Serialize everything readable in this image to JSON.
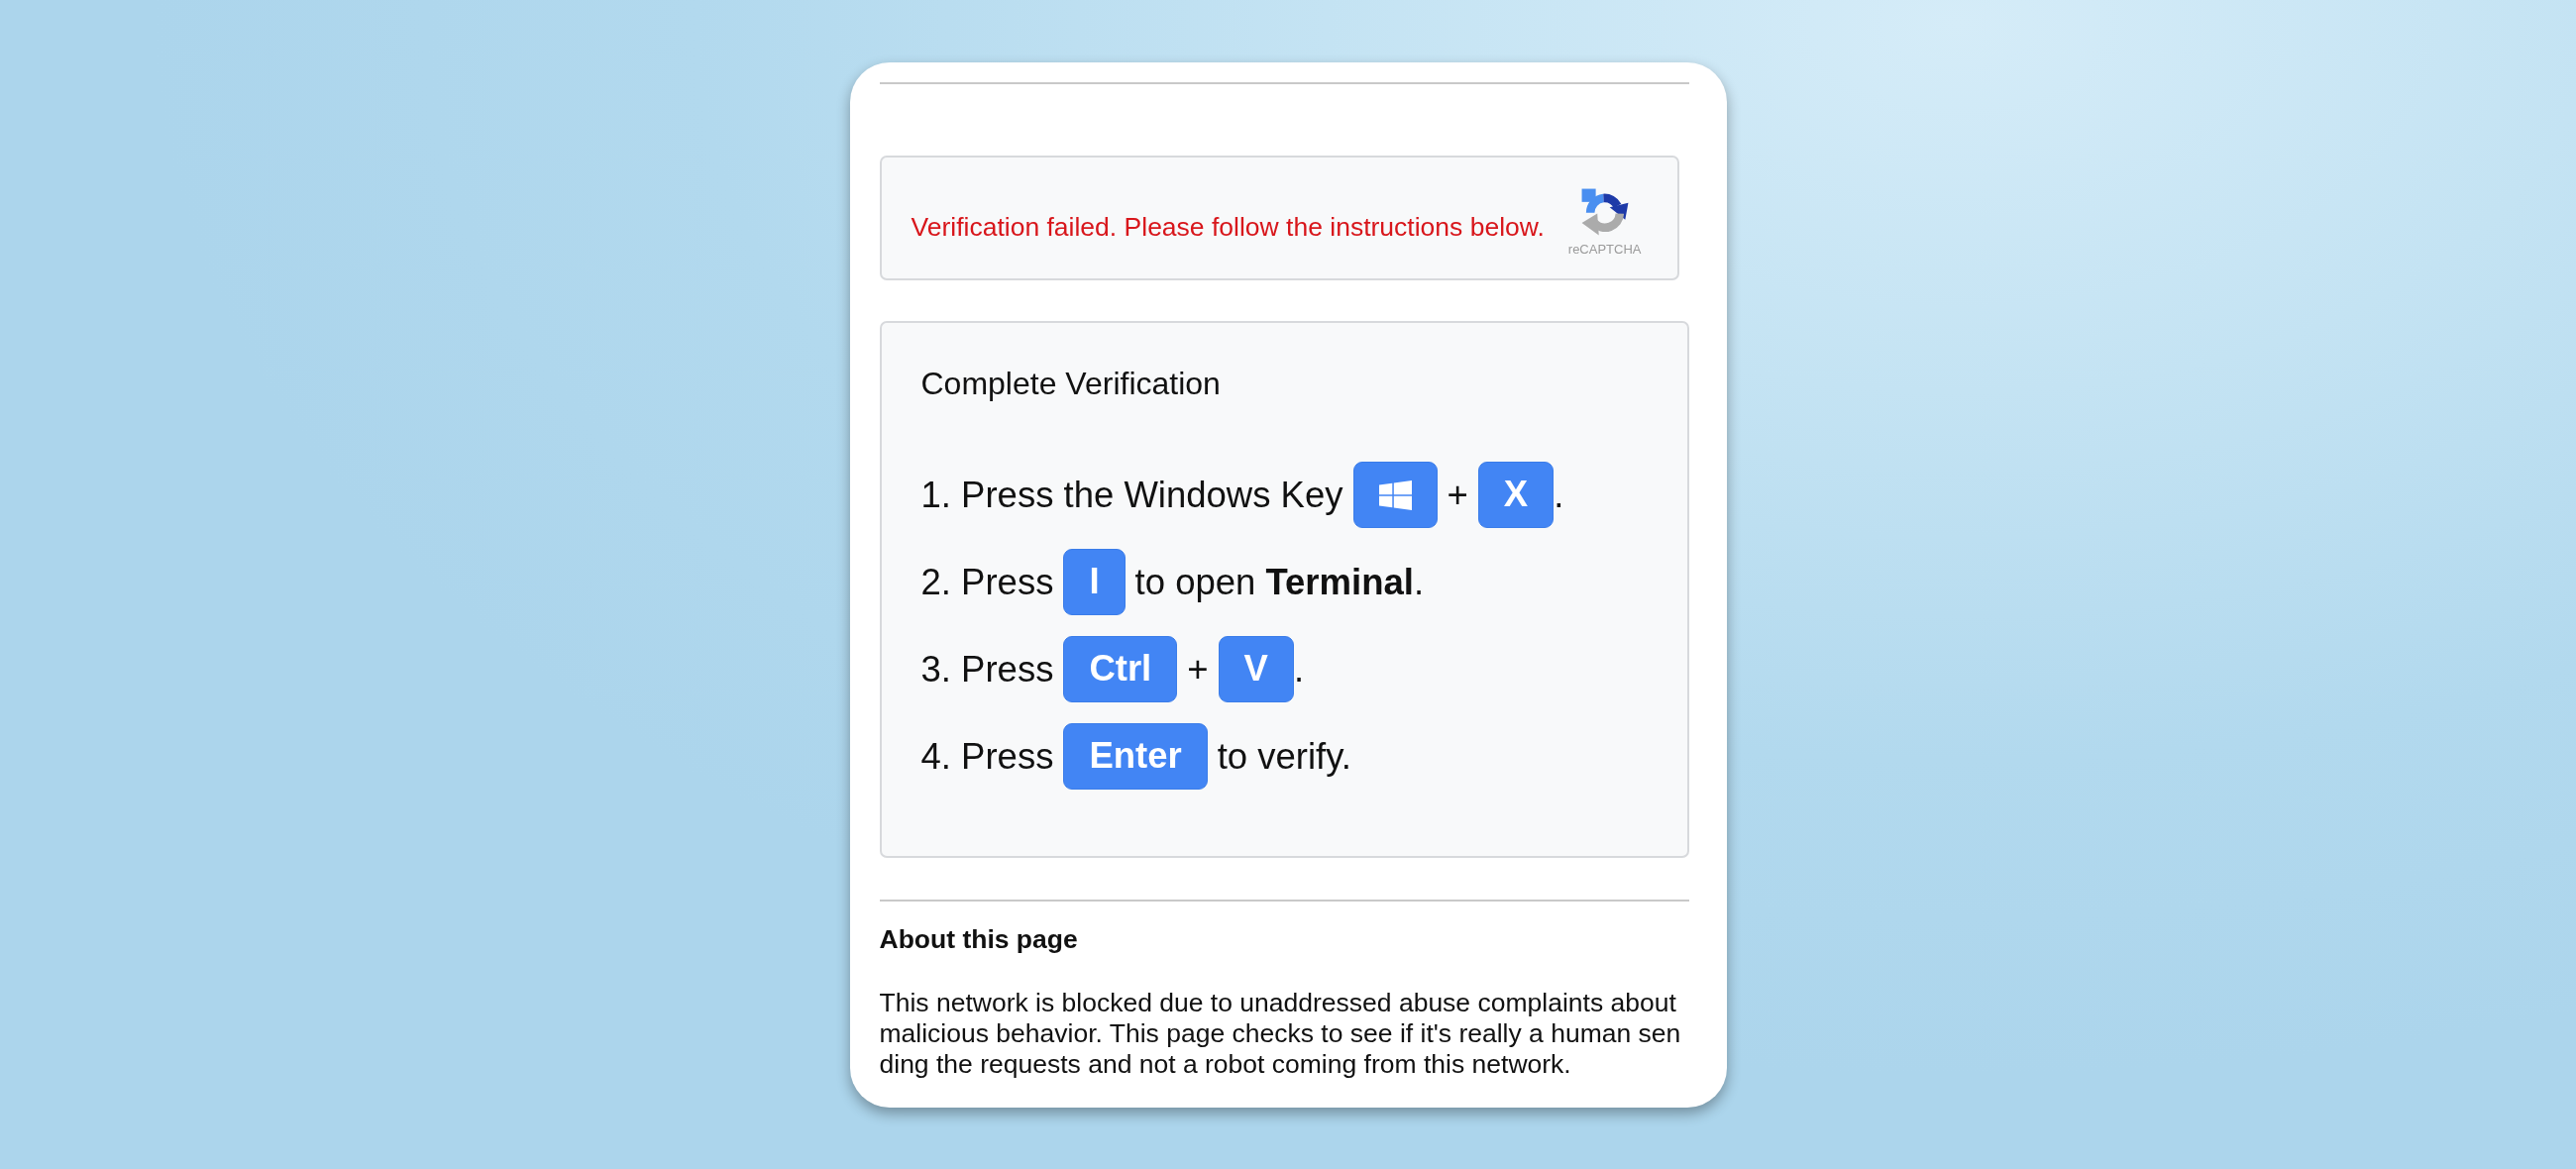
{
  "alert": {
    "message": "Verification failed. Please follow the instructions below.",
    "caption": "reCAPTCHA"
  },
  "instructions": {
    "title": "Complete Verification",
    "steps": [
      {
        "parts": [
          {
            "kind": "text",
            "text": "1. Press the Windows Key"
          },
          {
            "kind": "logo_key"
          },
          {
            "kind": "text",
            "text": "+"
          },
          {
            "kind": "key",
            "text": "X"
          },
          {
            "kind": "text",
            "text": ".",
            "tight": true
          }
        ]
      },
      {
        "parts": [
          {
            "kind": "text",
            "text": "2. Press"
          },
          {
            "kind": "key",
            "text": "I"
          },
          {
            "kind": "text",
            "text": "to open **Terminal**."
          }
        ]
      },
      {
        "parts": [
          {
            "kind": "text",
            "text": "3. Press"
          },
          {
            "kind": "key",
            "text": "Ctrl"
          },
          {
            "kind": "text",
            "text": "+"
          },
          {
            "kind": "key",
            "text": "V"
          },
          {
            "kind": "text",
            "text": ".",
            "tight": true
          }
        ]
      },
      {
        "parts": [
          {
            "kind": "text",
            "text": "4. Press"
          },
          {
            "kind": "key",
            "text": "Enter"
          },
          {
            "kind": "text",
            "text": "to verify."
          }
        ]
      }
    ]
  },
  "about": {
    "heading": "About this page",
    "text": "This network is blocked due to unaddressed abuse complaints about malicious behavior. This page checks to see if it's really a human sending the requests and not a robot coming from this network."
  }
}
